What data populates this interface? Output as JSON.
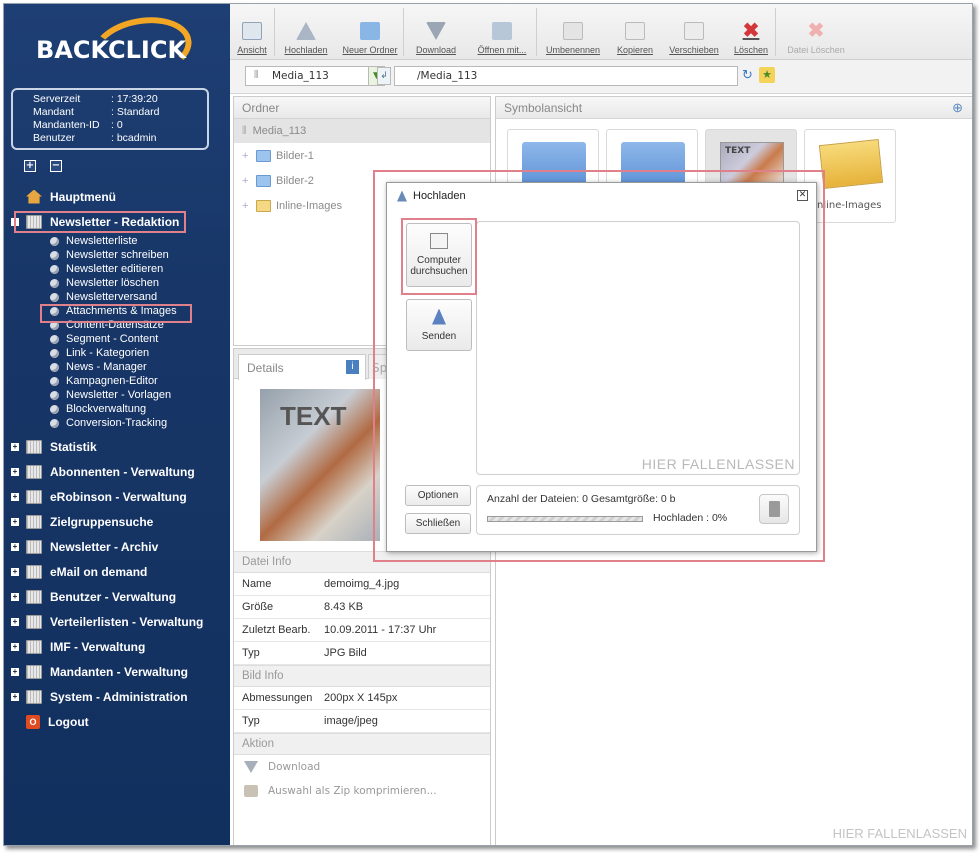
{
  "brand": {
    "logo_text": "BACKCLICK"
  },
  "session": {
    "rows": [
      {
        "key": "Serverzeit",
        "value": ": 17:39:20"
      },
      {
        "key": "Mandant",
        "value": ": Standard"
      },
      {
        "key": "Mandanten-ID",
        "value": ": 0"
      },
      {
        "key": "Benutzer",
        "value": ": bcadmin"
      }
    ]
  },
  "nav": {
    "home": "Hauptmenü",
    "newsletter_redaktion": "Newsletter - Redaktion",
    "sub_items": [
      "Newsletterliste",
      "Newsletter schreiben",
      "Newsletter editieren",
      "Newsletter löschen",
      "Newsletterversand",
      "Attachments & Images",
      "Content-Datensätze",
      "Segment - Content",
      "Link - Kategorien",
      "News - Manager",
      "Kampagnen-Editor",
      "Newsletter - Vorlagen",
      "Blockverwaltung",
      "Conversion-Tracking"
    ],
    "sections": [
      "Statistik",
      "Abonnenten - Verwaltung",
      "eRobinson - Verwaltung",
      "Zielgruppensuche",
      "Newsletter - Archiv",
      "eMail on demand",
      "Benutzer - Verwaltung",
      "Verteilerlisten - Verwaltung",
      "IMF - Verwaltung",
      "Mandanten - Verwaltung",
      "System - Administration"
    ],
    "logout": "Logout"
  },
  "toolbar": {
    "ansicht": "Ansicht",
    "hochladen": "Hochladen",
    "neuer_ordner": "Neuer Ordner",
    "download": "Download",
    "oeffnen": "Öffnen mit...",
    "umbenennen": "Umbenennen",
    "kopieren": "Kopieren",
    "verschieben": "Verschieben",
    "loeschen": "Löschen",
    "datei_loeschen": "Datei Löschen"
  },
  "pathbar": {
    "folder": "Media_113",
    "path": "/Media_113"
  },
  "ordner": {
    "title": "Ordner",
    "root": "Media_113",
    "children": [
      "Bilder-1",
      "Bilder-2",
      "Inline-Images"
    ]
  },
  "symbolansicht": {
    "title": "Symbolansicht",
    "thumb_text": "TEXT",
    "inline_label": "nline-Images",
    "drop_hint": "HIER FALLENLASSEN"
  },
  "details": {
    "tab": "Details",
    "tab2_partial": "Sp",
    "image_text": "TEXT",
    "datei_info_title": "Datei Info",
    "datei_info": [
      {
        "key": "Name",
        "value": "demoimg_4.jpg"
      },
      {
        "key": "Größe",
        "value": "8.43 KB"
      },
      {
        "key": "Zuletzt Bearb.",
        "value": "10.09.2011 - 17:37 Uhr"
      },
      {
        "key": "Typ",
        "value": "JPG Bild"
      }
    ],
    "bild_info_title": "Bild Info",
    "bild_info": [
      {
        "key": "Abmessungen",
        "value": "200px X 145px"
      },
      {
        "key": "Typ",
        "value": "image/jpeg"
      }
    ],
    "aktion_title": "Aktion",
    "actions": [
      "Download",
      "Auswahl als Zip komprimieren..."
    ]
  },
  "dialog": {
    "title": "Hochladen",
    "computer_btn_line1": "Computer",
    "computer_btn_line2": "durchsuchen",
    "senden": "Senden",
    "drop_hint": "HIER FALLENLASSEN",
    "optionen": "Optionen",
    "schliessen": "Schließen",
    "stats": "Anzahl der Dateien: 0 Gesamtgröße: 0 b",
    "upload_status": "Hochladen : 0%",
    "progress_fraction": 0
  },
  "colors": {
    "sidebar": "#173566",
    "accent_orange": "#f2a623",
    "highlight": "#e0808a"
  }
}
